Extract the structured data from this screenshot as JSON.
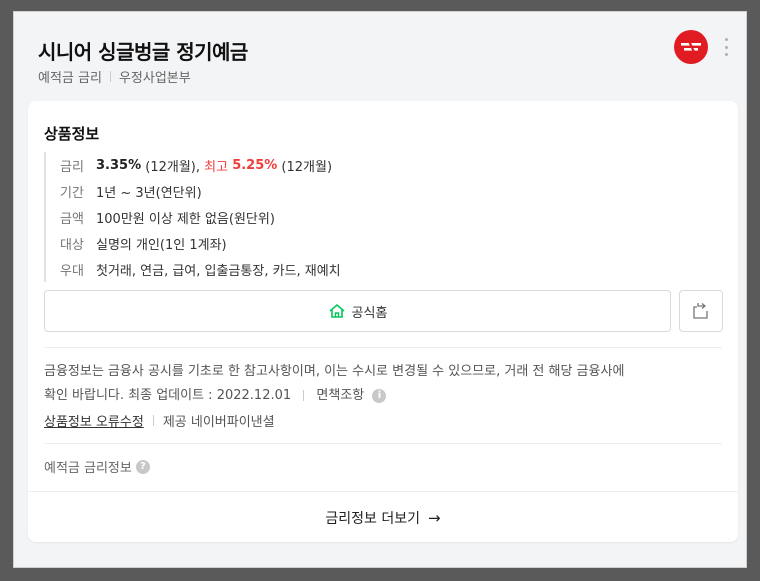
{
  "header": {
    "title": "시니어 싱글벙글 정기예금",
    "category": "예적금 금리",
    "provider": "우정사업본부",
    "brand_color": "#e11b22"
  },
  "product": {
    "section_title": "상품정보",
    "rate": {
      "label": "금리",
      "base_value": "3.35%",
      "base_term": " (12개월), ",
      "max_prefix": "최고 ",
      "max_value": "5.25%",
      "max_term": " (12개월)"
    },
    "period": {
      "label": "기간",
      "value": "1년 ~ 3년(연단위)"
    },
    "amount": {
      "label": "금액",
      "value": "100만원 이상 제한 없음(원단위)"
    },
    "target": {
      "label": "대상",
      "value": "실명의 개인(1인 1계좌)"
    },
    "benefit": {
      "label": "우대",
      "value": "첫거래, 연금, 급여, 입출금통장, 카드, 재예치"
    },
    "highlight_color": "#f23c3c"
  },
  "actions": {
    "homepage_label": "공식홈",
    "share_icon": "share-icon"
  },
  "notice": {
    "line1": "금융정보는 금융사 공시를 기초로 한 참고사항이며, 이는 수시로 변경될 수 있으므로, 거래 전 해당 금융사에",
    "line2_prefix": "확인 바랍니다. 최종 업데이트 : ",
    "update_date": "2022.12.01",
    "disclaimer": "면책조항"
  },
  "links": {
    "report_error": "상품정보 오류수정",
    "provided_by": "제공 네이버파이낸셜"
  },
  "rate_info": {
    "label": "예적금 금리정보"
  },
  "footer": {
    "more_label": "금리정보 더보기"
  }
}
